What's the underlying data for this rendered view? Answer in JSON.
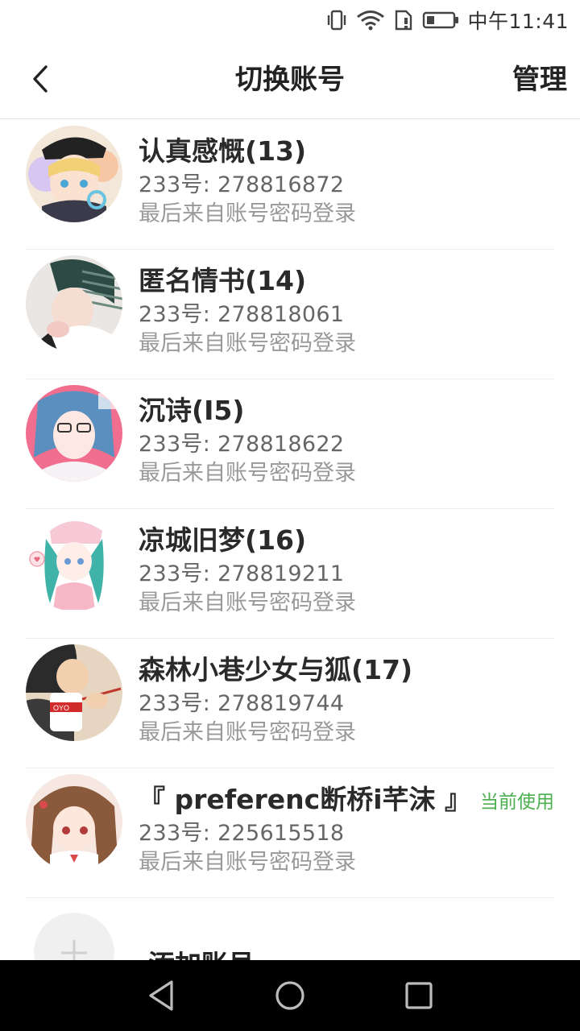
{
  "status_bar": {
    "time": "中午11:41",
    "icons": [
      "vibrate-icon",
      "wifi-icon",
      "sim-warning-icon",
      "battery-icon"
    ]
  },
  "header": {
    "back_icon": "chevron-left-icon",
    "title": "切换账号",
    "manage_label": "管理"
  },
  "accounts": [
    {
      "name": "认真感慨(13)",
      "id_line": "233号: 278816872",
      "login_source": "最后来自账号密码登录",
      "current": ""
    },
    {
      "name": "匿名情书(14)",
      "id_line": "233号: 278818061",
      "login_source": "最后来自账号密码登录",
      "current": ""
    },
    {
      "name": "沉诗(I5)",
      "id_line": "233号: 278818622",
      "login_source": "最后来自账号密码登录",
      "current": ""
    },
    {
      "name": "凉城旧梦(16)",
      "id_line": "233号: 278819211",
      "login_source": "最后来自账号密码登录",
      "current": ""
    },
    {
      "name": "森林小巷少女与狐(17)",
      "id_line": "233号: 278819744",
      "login_source": "最后来自账号密码登录",
      "current": ""
    },
    {
      "name": "『 preferenc断桥i芊沫 』",
      "id_line": "233号: 225615518",
      "login_source": "最后来自账号密码登录",
      "current": "当前使用"
    }
  ],
  "add_account": {
    "icon": "plus-icon",
    "label": "添加账号"
  },
  "nav_bar": {
    "buttons": [
      "back-triangle-icon",
      "home-circle-icon",
      "recents-square-icon"
    ]
  },
  "colors": {
    "accent_green": "#4caf50",
    "divider": "#ececec"
  }
}
